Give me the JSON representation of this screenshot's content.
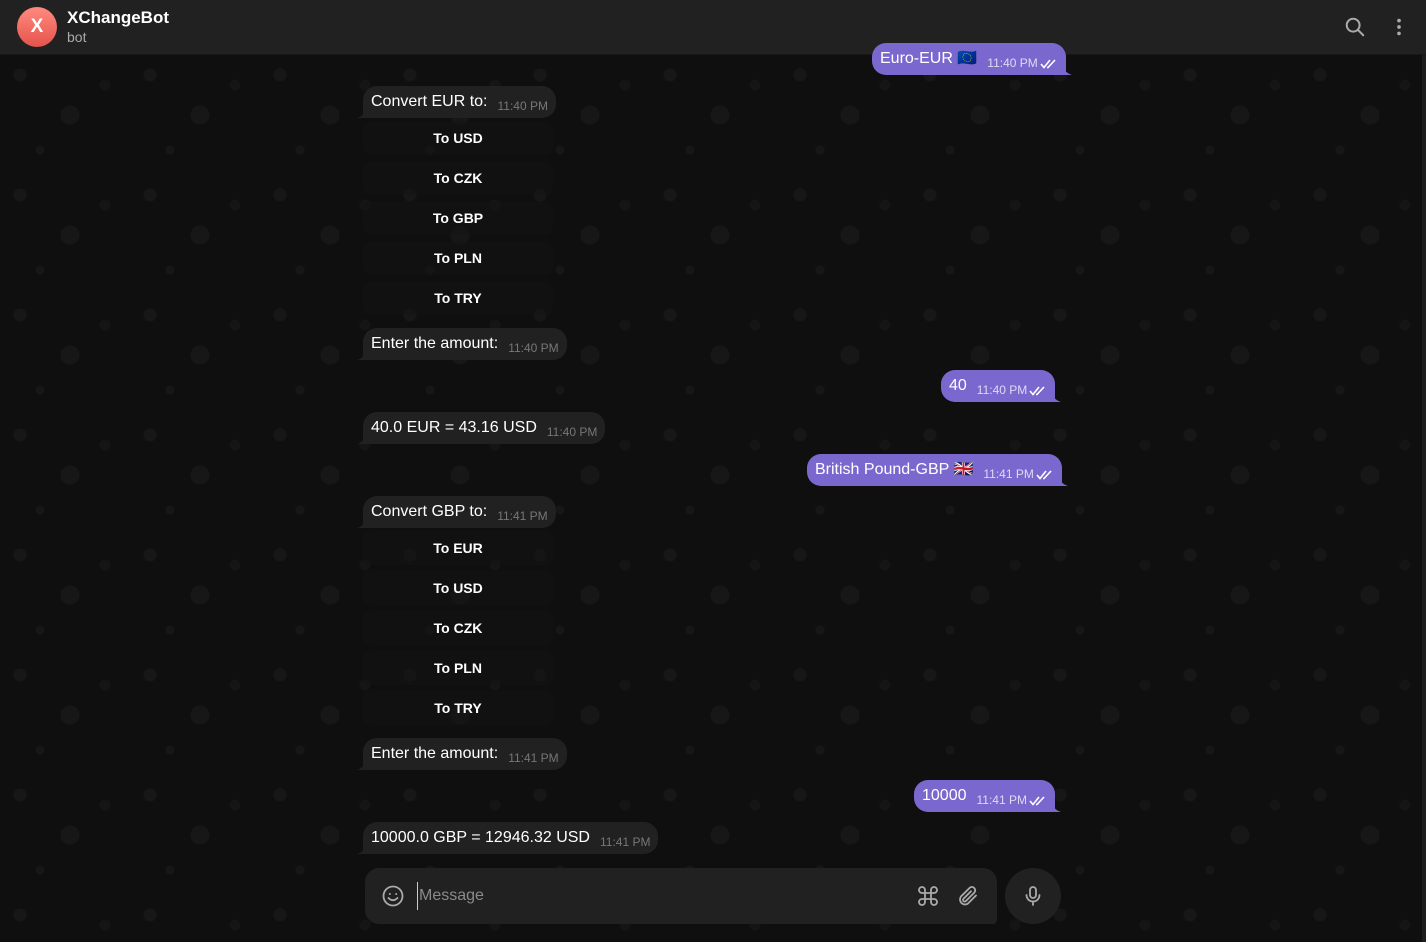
{
  "header": {
    "avatar_letter": "X",
    "title": "XChangeBot",
    "status": "bot"
  },
  "messages": [
    {
      "type": "out",
      "text": "Euro-EUR 🇪🇺",
      "time": "11:40 PM"
    },
    {
      "type": "in",
      "text": "Convert EUR to:",
      "time": "11:40 PM"
    },
    {
      "type": "in",
      "text": "Enter the amount:",
      "time": "11:40 PM"
    },
    {
      "type": "out",
      "text": "40",
      "time": "11:40 PM"
    },
    {
      "type": "in",
      "text": "40.0 EUR = 43.16 USD",
      "time": "11:40 PM"
    },
    {
      "type": "out",
      "text": "British Pound-GBP 🇬🇧",
      "time": "11:41 PM"
    },
    {
      "type": "in",
      "text": "Convert GBP to:",
      "time": "11:41 PM"
    },
    {
      "type": "in",
      "text": "Enter the amount:",
      "time": "11:41 PM"
    },
    {
      "type": "out",
      "text": "10000",
      "time": "11:41 PM"
    },
    {
      "type": "in",
      "text": "10000.0 GBP = 12946.32 USD",
      "time": "11:41 PM"
    }
  ],
  "keyboard_eur": [
    "To USD",
    "To CZK",
    "To GBP",
    "To PLN",
    "To TRY"
  ],
  "keyboard_gbp": [
    "To EUR",
    "To USD",
    "To CZK",
    "To PLN",
    "To TRY"
  ],
  "composer": {
    "placeholder": "Message"
  },
  "colors": {
    "outgoing_bubble": "#7b68cf",
    "incoming_bubble": "#212121",
    "header_bg": "#212121",
    "avatar": "#e5534b"
  },
  "icons": {
    "header": [
      "search-icon",
      "more-vertical-icon"
    ],
    "composer": [
      "emoji-icon",
      "command-icon",
      "attach-icon",
      "microphone-icon"
    ]
  }
}
